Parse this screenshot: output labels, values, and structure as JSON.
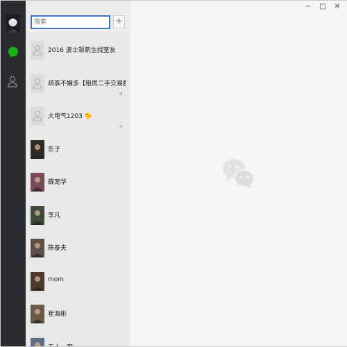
{
  "search": {
    "placeholder": "搜索"
  },
  "add_button": {
    "label": "+"
  },
  "window_controls": {
    "minimize": "−",
    "maximize": "□",
    "close": "✕"
  },
  "chats": [
    {
      "name": "2016 波士顿新生找室友",
      "avatar": "default-avatar",
      "muted": false
    },
    {
      "name": "疏蒸不嫌多【租房二手交易群】",
      "avatar": "default-avatar",
      "muted": true
    },
    {
      "name": "大电气1203 🐤",
      "avatar": "default-avatar",
      "muted": true
    },
    {
      "name": "东子",
      "avatar": "photo-avatar",
      "muted": false
    },
    {
      "name": "薛宠华",
      "avatar": "photo-avatar",
      "muted": false
    },
    {
      "name": "李凡",
      "avatar": "photo-avatar",
      "muted": false
    },
    {
      "name": "陈泰夫",
      "avatar": "photo-avatar",
      "muted": false
    },
    {
      "name": "mom",
      "avatar": "photo-avatar",
      "muted": false
    },
    {
      "name": "崔海彬",
      "avatar": "photo-avatar",
      "muted": false
    },
    {
      "name": "五人一家",
      "avatar": "photo-avatar",
      "muted": false
    }
  ],
  "colors": {
    "nav_bg": "#2b2c2f",
    "accent_green": "#1aad19",
    "search_border": "#3f77c8",
    "list_bg": "#e8e8e8",
    "main_bg": "#f5f5f5"
  }
}
